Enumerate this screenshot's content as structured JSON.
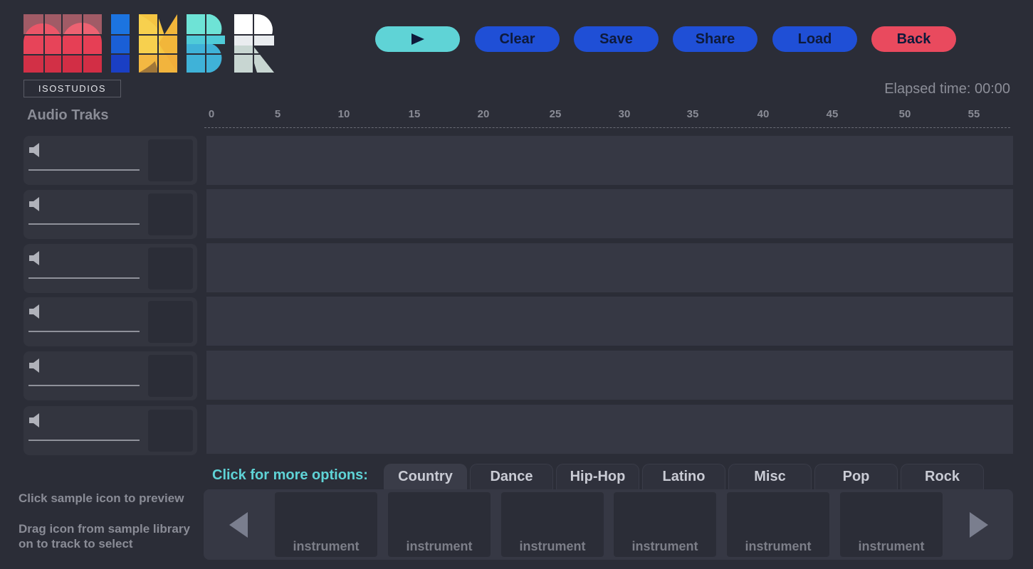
{
  "brand": {
    "name": "MIXBR",
    "subtitle": "ISOSTUDIOS"
  },
  "toolbar": {
    "play_icon": "play-icon",
    "clear_label": "Clear",
    "save_label": "Save",
    "share_label": "Share",
    "load_label": "Load",
    "back_label": "Back"
  },
  "colors": {
    "accent": "#5fd3d6",
    "primary": "#1f4fd6",
    "danger": "#e94a5e",
    "background": "#2b2d37"
  },
  "elapsed": "Elapsed time: 00:00",
  "tracks": {
    "title": "Audio Traks",
    "ruler": [
      "0",
      "5",
      "10",
      "15",
      "20",
      "25",
      "30",
      "35",
      "40",
      "45",
      "50",
      "55"
    ],
    "count": 6
  },
  "hints": {
    "preview": "Click sample icon to preview",
    "drag": "Drag icon from sample library on to track to select"
  },
  "library": {
    "options_label": "Click for more options:",
    "tabs": [
      "Country",
      "Dance",
      "Hip-Hop",
      "Latino",
      "Misc",
      "Pop",
      "Rock"
    ],
    "active_tab": "Country",
    "samples": [
      "instrument",
      "instrument",
      "instrument",
      "instrument",
      "instrument",
      "instrument"
    ]
  }
}
